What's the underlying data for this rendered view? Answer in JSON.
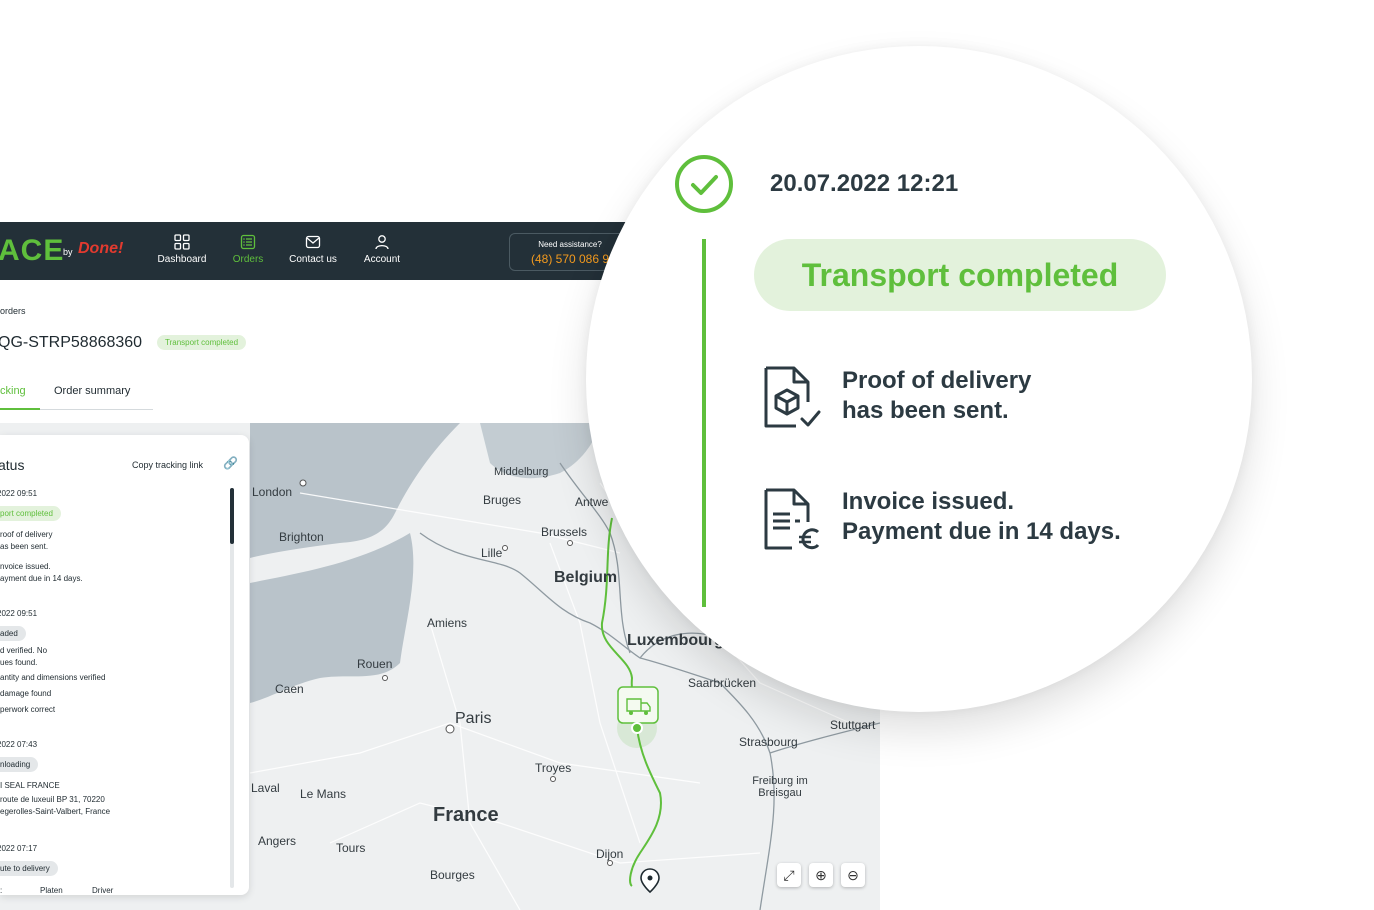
{
  "nav": {
    "logo": "ACE",
    "logo_by": "by",
    "logo_partner": "Done!",
    "items": [
      {
        "label": "Dashboard"
      },
      {
        "label": "Orders"
      },
      {
        "label": "Contact us"
      },
      {
        "label": "Account"
      }
    ],
    "assist_label": "Need assistance?",
    "assist_phone": "(48) 570 086 9"
  },
  "page": {
    "breadcrumb": "orders",
    "order_id": "QG-STRP58868360",
    "order_status": "Transport completed",
    "tabs": [
      {
        "label": "cking"
      },
      {
        "label": "Order summary"
      }
    ]
  },
  "status_panel": {
    "title": "atus",
    "copy_link": "Copy tracking link",
    "events": [
      {
        "date": "2022 09:51",
        "badge": "port completed",
        "lines": [
          "roof of delivery",
          "as been sent.",
          "",
          "nvoice issued.",
          "ayment due in 14 days."
        ]
      },
      {
        "date": "2022 09:51",
        "badge": "aded",
        "lines": [
          "d verified. No",
          "ues found.",
          "antity and dimensions verified",
          "damage found",
          "perwork correct"
        ]
      },
      {
        "date": "2022 07:43",
        "badge": "nloading",
        "lines": [
          "I SEAL FRANCE",
          "route de luxeuil BP 31, 70220",
          "egerolles-Saint-Valbert, France"
        ]
      },
      {
        "date": "2022 07:17",
        "badge": "ute to delivery",
        "lines": [
          ":",
          "Platen",
          "Driver"
        ]
      }
    ]
  },
  "map": {
    "labels": [
      {
        "text": "London"
      },
      {
        "text": "Middelburg"
      },
      {
        "text": "Bruges"
      },
      {
        "text": "Antwe"
      },
      {
        "text": "Brighton"
      },
      {
        "text": "Brussels"
      },
      {
        "text": "Lille"
      },
      {
        "text": "Belgium"
      },
      {
        "text": "Amiens"
      },
      {
        "text": "Luxembourg"
      },
      {
        "text": "Rouen"
      },
      {
        "text": "Caen"
      },
      {
        "text": "Saarbrücken"
      },
      {
        "text": "Paris"
      },
      {
        "text": "Stuttgart"
      },
      {
        "text": "Strasbourg"
      },
      {
        "text": "Troyes"
      },
      {
        "text": "Freiburg im Breisgau"
      },
      {
        "text": "Laval"
      },
      {
        "text": "Le Mans"
      },
      {
        "text": "France"
      },
      {
        "text": "Angers"
      },
      {
        "text": "Tours"
      },
      {
        "text": "Dijon"
      },
      {
        "text": "Bourges"
      }
    ],
    "controls": [
      "fullscreen-icon",
      "zoom-in-icon",
      "zoom-out-icon"
    ]
  },
  "callout": {
    "timestamp": "20.07.2022 12:21",
    "status": "Transport completed",
    "proof_line1": "Proof of delivery",
    "proof_line2": "has been sent.",
    "invoice_line1": "Invoice issued.",
    "invoice_line2": "Payment due in 14 days."
  },
  "colors": {
    "accent": "#5fbf3c",
    "nav_bg": "#233038",
    "badge_bg": "#e3f2dc",
    "phone": "#f39a1e",
    "text_dark": "#2c3a42"
  }
}
